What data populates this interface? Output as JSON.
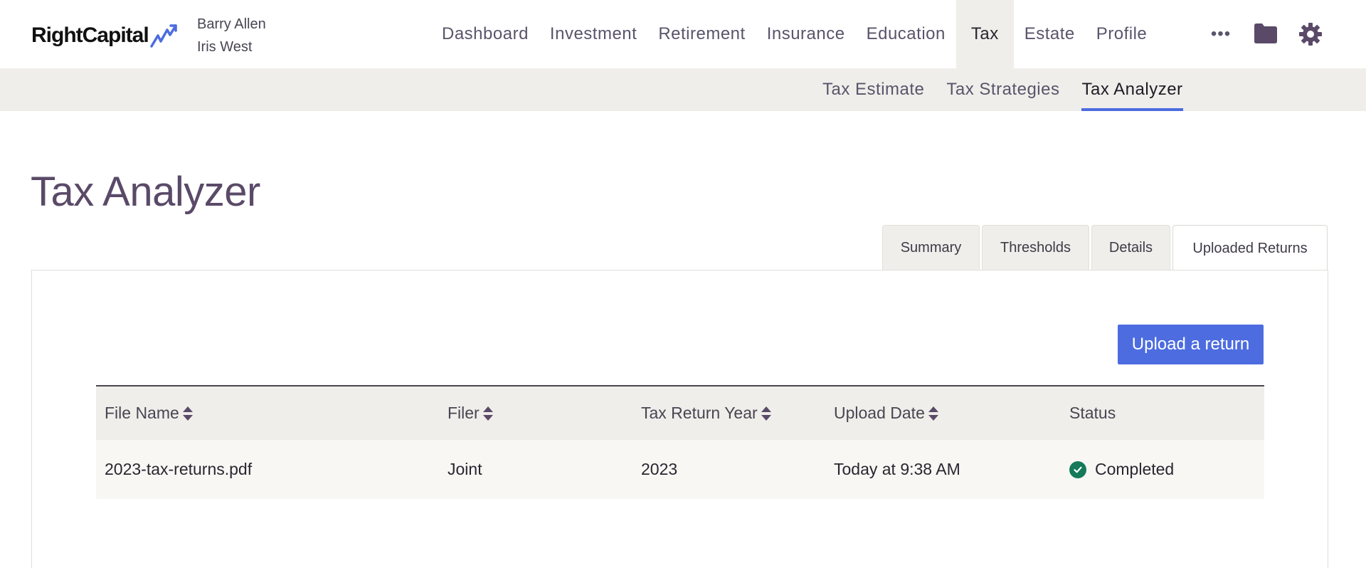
{
  "app": {
    "logo_text": "RightCapital",
    "clients": [
      "Barry Allen",
      "Iris West"
    ]
  },
  "nav": {
    "items": [
      {
        "label": "Dashboard",
        "active": false
      },
      {
        "label": "Investment",
        "active": false
      },
      {
        "label": "Retirement",
        "active": false
      },
      {
        "label": "Insurance",
        "active": false
      },
      {
        "label": "Education",
        "active": false
      },
      {
        "label": "Tax",
        "active": true
      },
      {
        "label": "Estate",
        "active": false
      },
      {
        "label": "Profile",
        "active": false
      }
    ],
    "more_label": "•••",
    "icons": [
      "folder-icon",
      "gear-icon"
    ]
  },
  "subnav": {
    "items": [
      {
        "label": "Tax Estimate",
        "active": false
      },
      {
        "label": "Tax Strategies",
        "active": false
      },
      {
        "label": "Tax Analyzer",
        "active": true
      }
    ]
  },
  "page": {
    "title": "Tax Analyzer"
  },
  "tabs": [
    {
      "label": "Summary",
      "active": false
    },
    {
      "label": "Thresholds",
      "active": false
    },
    {
      "label": "Details",
      "active": false
    },
    {
      "label": "Uploaded Returns",
      "active": true
    }
  ],
  "upload_button_label": "Upload a return",
  "table": {
    "columns": [
      {
        "label": "File Name",
        "sortable": true
      },
      {
        "label": "Filer",
        "sortable": true
      },
      {
        "label": "Tax Return Year",
        "sortable": true
      },
      {
        "label": "Upload Date",
        "sortable": true
      },
      {
        "label": "Status",
        "sortable": false
      }
    ],
    "rows": [
      {
        "file_name": "2023-tax-returns.pdf",
        "filer": "Joint",
        "year": "2023",
        "upload_date": "Today at 9:38 AM",
        "status": "Completed"
      }
    ]
  },
  "colors": {
    "accent": "#4c6ce0",
    "title": "#5a4a68",
    "status_success": "#157a5a",
    "subnav_bg": "#efeeea"
  }
}
